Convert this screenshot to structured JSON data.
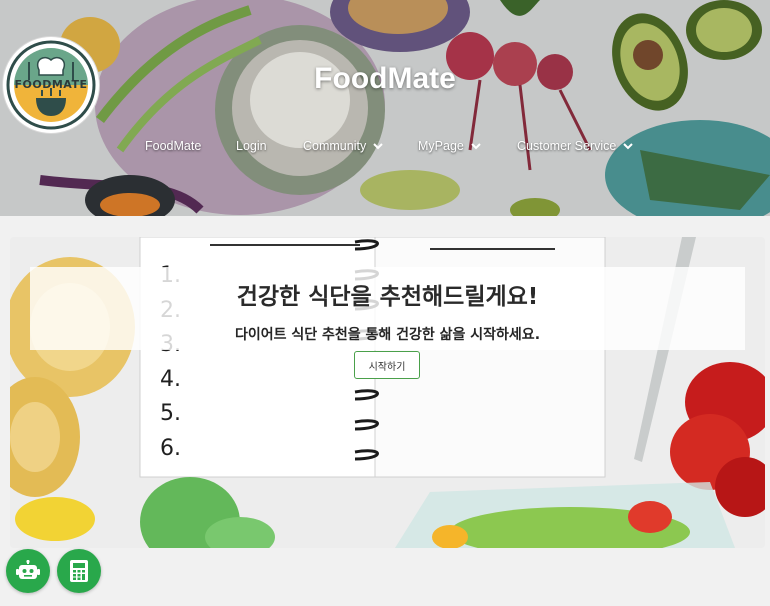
{
  "site": {
    "title": "FoodMate",
    "logo_text": "FOODMATE"
  },
  "nav": {
    "items": [
      {
        "label": "FoodMate",
        "has_dropdown": false
      },
      {
        "label": "Login",
        "has_dropdown": false
      },
      {
        "label": "Community",
        "has_dropdown": true
      },
      {
        "label": "MyPage",
        "has_dropdown": true
      },
      {
        "label": "Customer Service",
        "has_dropdown": true
      }
    ]
  },
  "hero": {
    "title": "건강한 식단을 추천해드릴게요!",
    "subtitle": "다이어트 식단 추천을 통해 건강한 삶을 시작하세요.",
    "button_label": "시작하기",
    "notebook_numbers": [
      "1.",
      "2.",
      "3.",
      "4.",
      "5.",
      "6."
    ]
  },
  "floating_buttons": [
    {
      "icon": "robot-icon"
    },
    {
      "icon": "calculator-icon"
    }
  ],
  "colors": {
    "accent": "#29a84b",
    "page_bg": "#f1f1f1",
    "header_text": "#ffffff"
  }
}
